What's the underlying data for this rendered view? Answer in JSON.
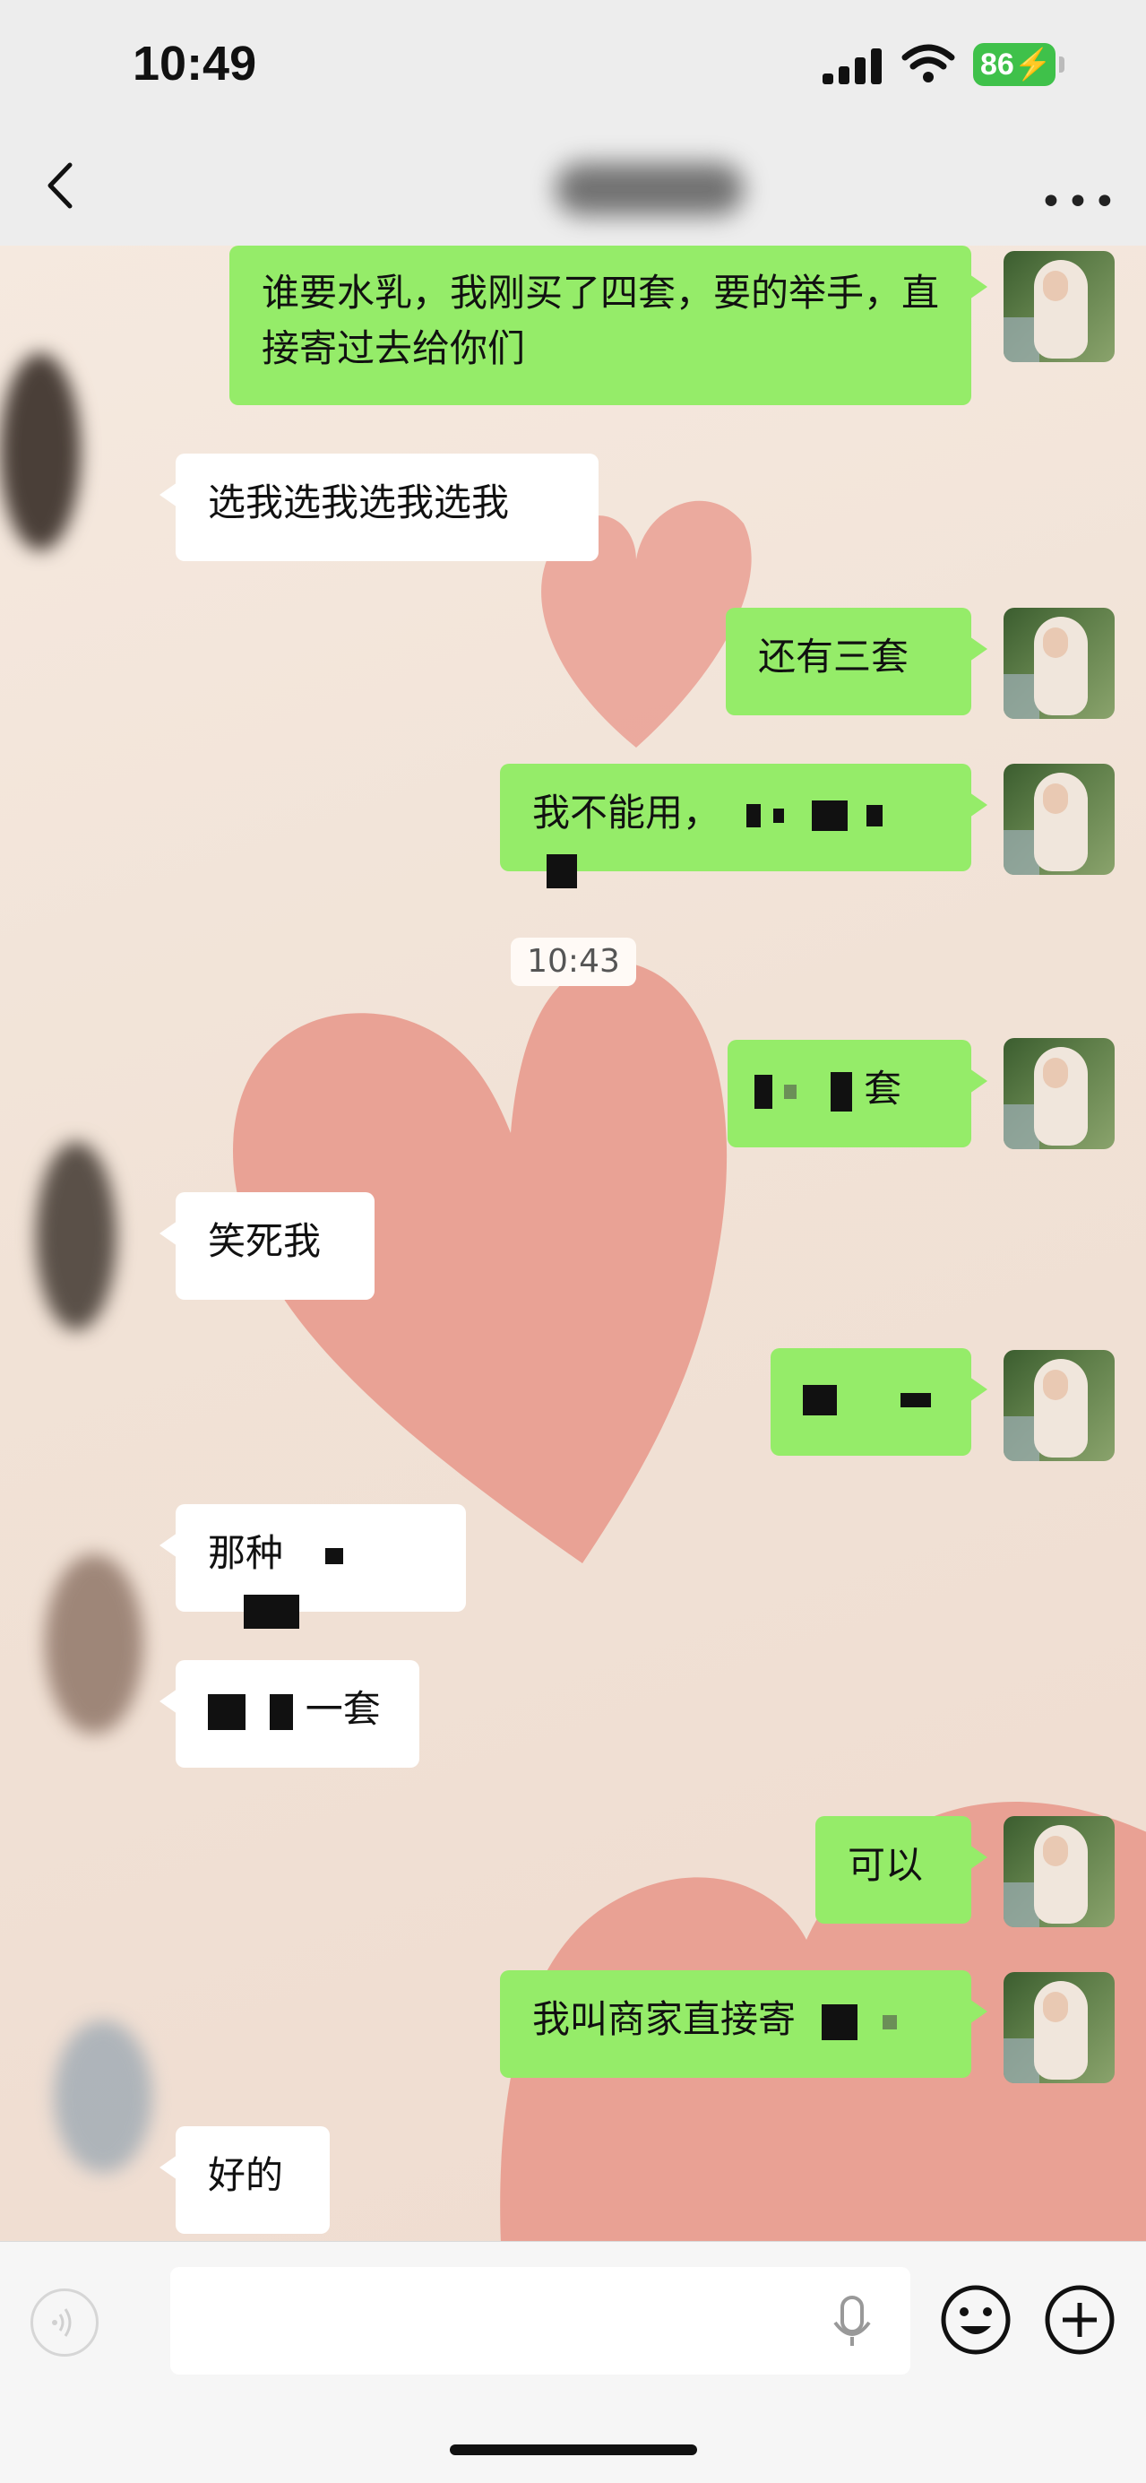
{
  "status_bar": {
    "time": "10:49",
    "battery": "86"
  },
  "nav": {
    "back_icon": "chevron-left-icon",
    "more_icon": "more-dots-icon",
    "more_label": "•••"
  },
  "timestamp": "10:43",
  "messages": [
    {
      "side": "me",
      "text": "谁要水乳，我刚买了四套，要的举手，直接寄过去给你们"
    },
    {
      "side": "them",
      "text": "选我选我选我选我"
    },
    {
      "side": "me",
      "text": "还有三套"
    },
    {
      "side": "me",
      "text": "我不能用，"
    },
    {
      "side": "me",
      "text": "套"
    },
    {
      "side": "them",
      "text": "笑死我"
    },
    {
      "side": "me",
      "text": ""
    },
    {
      "side": "them",
      "text": "那种"
    },
    {
      "side": "them",
      "text": "一套"
    },
    {
      "side": "me",
      "text": "可以"
    },
    {
      "side": "me",
      "text": "我叫商家直接寄"
    },
    {
      "side": "them",
      "text": "好的"
    }
  ],
  "input_bar": {
    "placeholder": "",
    "icons": [
      "voice-icon",
      "microphone-icon",
      "emoji-icon",
      "plus-icon"
    ]
  },
  "colors": {
    "me_bubble": "#95ec69",
    "them_bubble": "#ffffff",
    "heart": "#e8968a",
    "bar_bg": "#ededed"
  }
}
